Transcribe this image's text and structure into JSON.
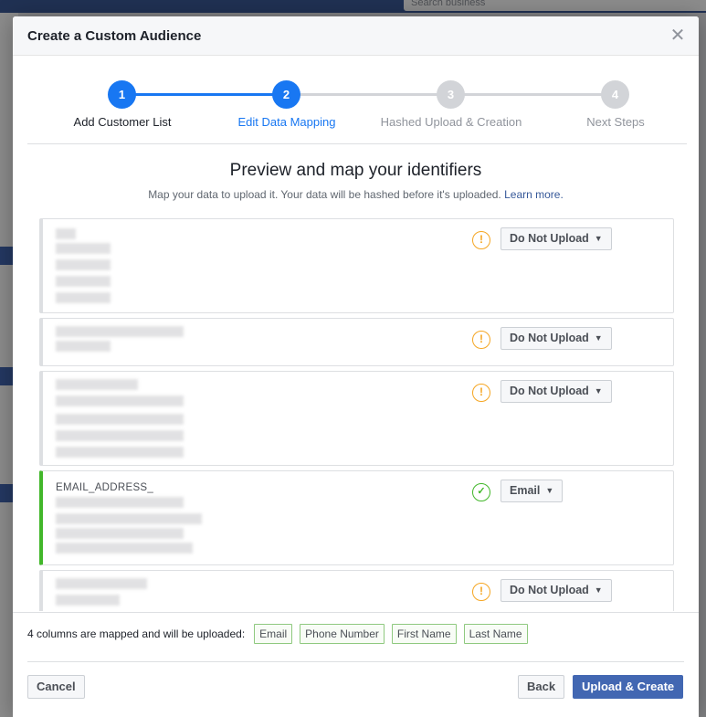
{
  "background": {
    "search_placeholder": "Search business"
  },
  "dialog": {
    "title": "Create a Custom Audience",
    "close_icon": "close-icon"
  },
  "stepper": {
    "steps": [
      {
        "number": "1",
        "label": "Add Customer List",
        "state": "complete"
      },
      {
        "number": "2",
        "label": "Edit Data Mapping",
        "state": "active"
      },
      {
        "number": "3",
        "label": "Hashed Upload & Creation",
        "state": "pending"
      },
      {
        "number": "4",
        "label": "Next Steps",
        "state": "pending"
      }
    ],
    "colors": {
      "active": "#1877f2",
      "pending": "#d2d4d8",
      "active_label": "#1877f2",
      "pending_label": "#90949c"
    }
  },
  "preview": {
    "title": "Preview and map your identifiers",
    "subtitle": "Map your data to upload it. Your data will be hashed before it's uploaded.",
    "learn_more": "Learn more."
  },
  "columns": [
    {
      "name": "",
      "status": "warning",
      "mapping": "Do Not Upload"
    },
    {
      "name": "",
      "status": "warning",
      "mapping": "Do Not Upload"
    },
    {
      "name": "",
      "status": "warning",
      "mapping": "Do Not Upload"
    },
    {
      "name": "EMAIL_ADDRESS_",
      "status": "mapped",
      "mapping": "Email"
    },
    {
      "name": "",
      "status": "warning",
      "mapping": "Do Not Upload"
    }
  ],
  "mapped_summary": {
    "text": "4 columns are mapped and will be uploaded:",
    "tags": [
      "Email",
      "Phone Number",
      "First Name",
      "Last Name"
    ]
  },
  "footer": {
    "cancel_label": "Cancel",
    "back_label": "Back",
    "upload_label": "Upload & Create"
  }
}
